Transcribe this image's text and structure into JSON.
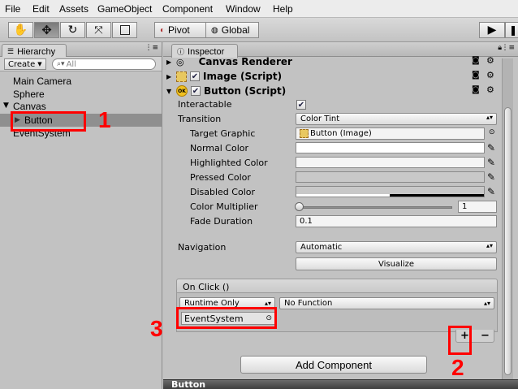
{
  "menubar": {
    "items": [
      "File",
      "Edit",
      "Assets",
      "GameObject",
      "Component",
      "Window",
      "Help"
    ]
  },
  "toolbar": {
    "pivot_label": "Pivot",
    "global_label": "Global"
  },
  "hierarchy": {
    "tab_label": "Hierarchy",
    "create_label": "Create",
    "search_placeholder": "All",
    "items": [
      "Main Camera",
      "Sphere",
      "Canvas",
      "Button",
      "EventSystem"
    ]
  },
  "inspector": {
    "tab_label": "Inspector",
    "components": [
      "Canvas Renderer",
      "Image (Script)",
      "Button (Script)"
    ],
    "interactable_label": "Interactable",
    "transition_label": "Transition",
    "transition_value": "Color Tint",
    "target_graphic_label": "Target Graphic",
    "target_graphic_value": "Button (Image)",
    "normal_color_label": "Normal Color",
    "highlighted_color_label": "Highlighted Color",
    "pressed_color_label": "Pressed Color",
    "disabled_color_label": "Disabled Color",
    "color_multiplier_label": "Color Multiplier",
    "color_multiplier_value": "1",
    "fade_duration_label": "Fade Duration",
    "fade_duration_value": "0.1",
    "navigation_label": "Navigation",
    "navigation_value": "Automatic",
    "visualize_label": "Visualize",
    "onclick_label": "On Click ()",
    "runtime_value": "Runtime Only",
    "function_value": "No Function",
    "object_value": "EventSystem",
    "plus_label": "+",
    "minus_label": "−",
    "add_component_label": "Add Component",
    "bottom_label": "Button"
  },
  "annotations": [
    "1",
    "2",
    "3"
  ],
  "colors": {
    "annotation": "#ff0000",
    "selected_row": "#8f8f8f"
  }
}
